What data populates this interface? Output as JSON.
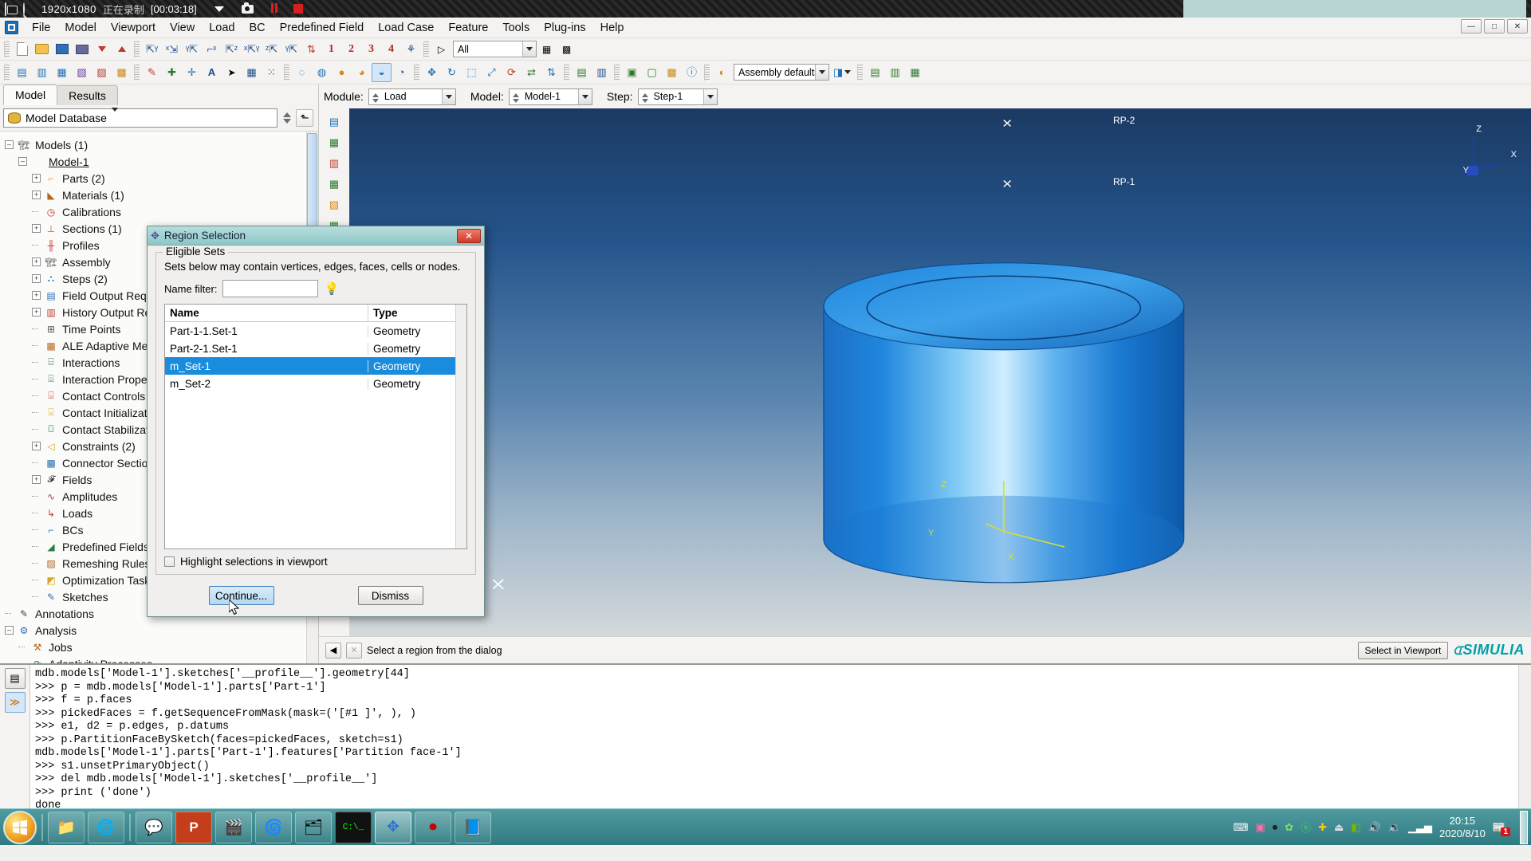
{
  "recorder": {
    "resolution": "1920x1080",
    "status_zh": "正在录制",
    "time": "[00:03:18]"
  },
  "menu": {
    "items": [
      "File",
      "Model",
      "Viewport",
      "View",
      "Load",
      "BC",
      "Predefined Field",
      "Load Case",
      "Feature",
      "Tools",
      "Plug-ins",
      "Help"
    ],
    "win_buttons": [
      "—",
      "□",
      "✕"
    ]
  },
  "toolbar2": {
    "filter_value": "All",
    "numbers": [
      "1",
      "2",
      "3",
      "4"
    ]
  },
  "toolbar3": {
    "render_value": "Assembly defaults"
  },
  "left_panel": {
    "tabs": [
      {
        "label": "Model",
        "active": true
      },
      {
        "label": "Results",
        "active": false
      }
    ],
    "database_label": "Model Database",
    "tree": [
      {
        "label": "Models (1)",
        "depth": 0,
        "toggle": "-",
        "icon": "assembly-icon",
        "underline": false
      },
      {
        "label": "Model-1",
        "depth": 1,
        "toggle": "-",
        "icon": "none",
        "underline": true
      },
      {
        "label": "Parts (2)",
        "depth": 2,
        "toggle": "+",
        "icon": "parts-icon",
        "underline": false
      },
      {
        "label": "Materials (1)",
        "depth": 2,
        "toggle": "+",
        "icon": "materials-icon",
        "underline": false
      },
      {
        "label": "Calibrations",
        "depth": 2,
        "toggle": ".",
        "icon": "calibrations-icon",
        "underline": false
      },
      {
        "label": "Sections (1)",
        "depth": 2,
        "toggle": "+",
        "icon": "sections-icon",
        "underline": false
      },
      {
        "label": "Profiles",
        "depth": 2,
        "toggle": ".",
        "icon": "profiles-icon",
        "underline": false
      },
      {
        "label": "Assembly",
        "depth": 2,
        "toggle": "+",
        "icon": "assembly-icon",
        "underline": false
      },
      {
        "label": "Steps (2)",
        "depth": 2,
        "toggle": "+",
        "icon": "steps-icon",
        "underline": false
      },
      {
        "label": "Field Output Requests",
        "depth": 2,
        "toggle": "+",
        "icon": "field-output-icon",
        "underline": false
      },
      {
        "label": "History Output Requests",
        "depth": 2,
        "toggle": "+",
        "icon": "history-output-icon",
        "underline": false
      },
      {
        "label": "Time Points",
        "depth": 2,
        "toggle": ".",
        "icon": "time-points-icon",
        "underline": false
      },
      {
        "label": "ALE Adaptive Mesh Constraints",
        "depth": 2,
        "toggle": ".",
        "icon": "ale-icon",
        "underline": false
      },
      {
        "label": "Interactions",
        "depth": 2,
        "toggle": ".",
        "icon": "interactions-icon",
        "underline": false
      },
      {
        "label": "Interaction Properties",
        "depth": 2,
        "toggle": ".",
        "icon": "interaction-prop-icon",
        "underline": false
      },
      {
        "label": "Contact Controls",
        "depth": 2,
        "toggle": ".",
        "icon": "contact-controls-icon",
        "underline": false
      },
      {
        "label": "Contact Initializations",
        "depth": 2,
        "toggle": ".",
        "icon": "contact-init-icon",
        "underline": false
      },
      {
        "label": "Contact Stabilizations",
        "depth": 2,
        "toggle": ".",
        "icon": "contact-stab-icon",
        "underline": false
      },
      {
        "label": "Constraints (2)",
        "depth": 2,
        "toggle": "+",
        "icon": "constraints-icon",
        "underline": false
      },
      {
        "label": "Connector Sections",
        "depth": 2,
        "toggle": ".",
        "icon": "connector-icon",
        "underline": false
      },
      {
        "label": "Fields",
        "depth": 2,
        "toggle": "+",
        "icon": "fields-icon",
        "underline": false
      },
      {
        "label": "Amplitudes",
        "depth": 2,
        "toggle": ".",
        "icon": "amplitudes-icon",
        "underline": false
      },
      {
        "label": "Loads",
        "depth": 2,
        "toggle": ".",
        "icon": "loads-icon",
        "underline": false
      },
      {
        "label": "BCs",
        "depth": 2,
        "toggle": ".",
        "icon": "bcs-icon",
        "underline": false
      },
      {
        "label": "Predefined Fields",
        "depth": 2,
        "toggle": ".",
        "icon": "predefined-fields-icon",
        "underline": false
      },
      {
        "label": "Remeshing Rules",
        "depth": 2,
        "toggle": ".",
        "icon": "remeshing-icon",
        "underline": false
      },
      {
        "label": "Optimization Tasks",
        "depth": 2,
        "toggle": ".",
        "icon": "optimization-icon",
        "underline": false
      },
      {
        "label": "Sketches",
        "depth": 2,
        "toggle": ".",
        "icon": "sketches-icon",
        "underline": false
      },
      {
        "label": "Annotations",
        "depth": 0,
        "toggle": ".",
        "icon": "annotations-icon",
        "underline": false
      },
      {
        "label": "Analysis",
        "depth": 0,
        "toggle": "-",
        "icon": "analysis-icon",
        "underline": false
      },
      {
        "label": "Jobs",
        "depth": 1,
        "toggle": ".",
        "icon": "jobs-icon",
        "underline": false
      },
      {
        "label": "Adaptivity Processes",
        "depth": 1,
        "toggle": ".",
        "icon": "adaptivity-icon",
        "underline": false
      }
    ]
  },
  "context_bar": {
    "module_label": "Module:",
    "module_value": "Load",
    "model_label": "Model:",
    "model_value": "Model-1",
    "step_label": "Step:",
    "step_value": "Step-1"
  },
  "viewport": {
    "rp2_label": "RP-2",
    "rp1_label": "RP-1",
    "triad_axes": [
      "Z",
      "Y",
      "X"
    ],
    "nav_triad_axes": [
      "Z",
      "Y",
      "X"
    ],
    "origin_marker": "X"
  },
  "status_bar": {
    "message": "Select a region from the dialog",
    "select_in_viewport": "Select in Viewport",
    "brand": "SIMULIA"
  },
  "dialog": {
    "title": "Region Selection",
    "close_label": "✕",
    "group_legend": "Eligible Sets",
    "hint": "Sets below may contain vertices, edges, faces, cells or nodes.",
    "filter_label": "Name filter:",
    "filter_value": "",
    "columns": [
      "Name",
      "Type"
    ],
    "rows": [
      {
        "name": "Part-1-1.Set-1",
        "type": "Geometry",
        "selected": false
      },
      {
        "name": "Part-2-1.Set-1",
        "type": "Geometry",
        "selected": false
      },
      {
        "name": "m_Set-1",
        "type": "Geometry",
        "selected": true
      },
      {
        "name": "m_Set-2",
        "type": "Geometry",
        "selected": false
      }
    ],
    "checkbox_label": "Highlight selections in viewport",
    "checkbox_checked": false,
    "continue_label": "Continue...",
    "dismiss_label": "Dismiss"
  },
  "console": {
    "lines": [
      "mdb.models['Model-1'].sketches['__profile__'].geometry[44]",
      ">>> p = mdb.models['Model-1'].parts['Part-1']",
      ">>> f = p.faces",
      ">>> pickedFaces = f.getSequenceFromMask(mask=('[#1 ]', ), )",
      ">>> e1, d2 = p.edges, p.datums",
      ">>> p.PartitionFaceBySketch(faces=pickedFaces, sketch=s1)",
      "mdb.models['Model-1'].parts['Part-1'].features['Partition face-1']",
      ">>> s1.unsetPrimaryObject()",
      ">>> del mdb.models['Model-1'].sketches['__profile__']",
      ">>> print ('done')",
      "done",
      ">>>"
    ]
  },
  "taskbar": {
    "time": "20:15",
    "date": "2020/8/10",
    "notification_count": "1"
  },
  "colors": {
    "accent": "#1a8cdd",
    "dialog_title": "#8ec6c6",
    "taskbar": "#2f7b82",
    "brand": "#00a0a8",
    "model_blue": "#1e7fd4"
  }
}
